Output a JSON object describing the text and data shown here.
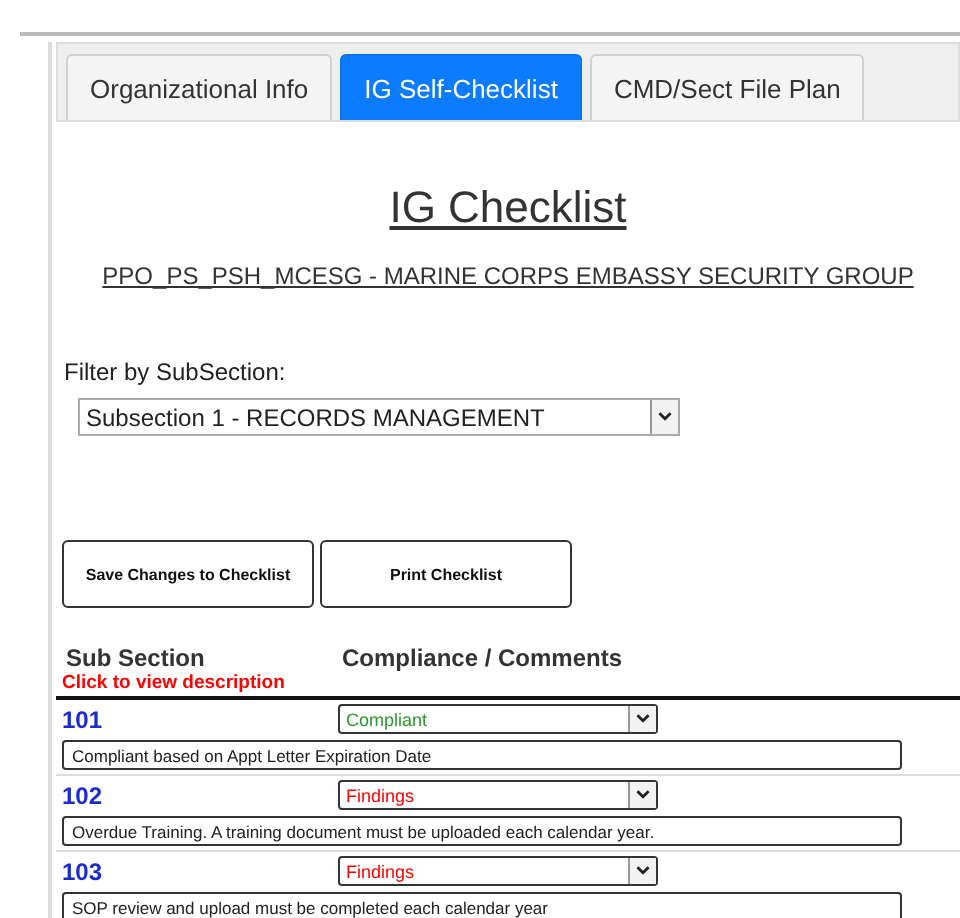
{
  "tabs": [
    {
      "label": "Organizational Info",
      "selected": false
    },
    {
      "label": "IG Self-Checklist",
      "selected": true
    },
    {
      "label": "CMD/Sect File Plan",
      "selected": false
    }
  ],
  "title": "IG Checklist",
  "subtitle": "PPO_PS_PSH_MCESG - MARINE CORPS EMBASSY SECURITY GROUP",
  "filter": {
    "label": "Filter by SubSection:",
    "value": "Subsection 1 - RECORDS MANAGEMENT"
  },
  "buttons": [
    "Save Changes to Checklist",
    "Print Checklist"
  ],
  "table": {
    "columns": [
      "Sub Section",
      "Compliance / Comments"
    ],
    "hint": "Click to view description",
    "rows": [
      {
        "number": "101",
        "compliance": "Compliant",
        "kind": "compliant",
        "comment": "Compliant based on Appt Letter Expiration Date"
      },
      {
        "number": "102",
        "compliance": "Findings",
        "kind": "findings",
        "comment": "Overdue Training. A training document must be uploaded each calendar year."
      },
      {
        "number": "103",
        "compliance": "Findings",
        "kind": "findings",
        "comment": "SOP review and upload must be completed each calendar year"
      }
    ]
  }
}
